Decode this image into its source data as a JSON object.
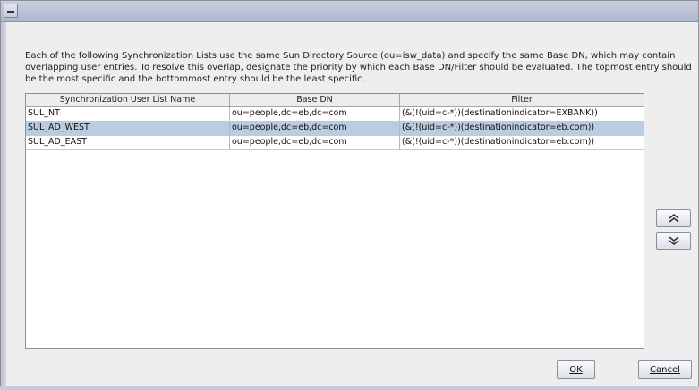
{
  "window": {
    "description": "Each of the following Synchronization Lists use the same Sun Directory Source (ou=isw_data) and specify the same Base DN, which may contain overlapping user entries. To resolve this overlap, designate the priority by which each Base DN/Filter should be evaluated.  The topmost entry should be the most specific and the bottommost entry should be the least specific."
  },
  "table": {
    "headers": [
      "Synchronization User List Name",
      "Base DN",
      "Filter"
    ],
    "rows": [
      {
        "name": "SUL_NT",
        "base_dn": "ou=people,dc=eb,dc=com",
        "filter": "(&(!(uid=c-*))(destinationindicator=EXBANK))",
        "selected": false
      },
      {
        "name": "SUL_AD_WEST",
        "base_dn": "ou=people,dc=eb,dc=com",
        "filter": "(&(!(uid=c-*))(destinationindicator=eb.com))",
        "selected": true
      },
      {
        "name": "SUL_AD_EAST",
        "base_dn": "ou=people,dc=eb,dc=com",
        "filter": "(&(!(uid=c-*))(destinationindicator=eb.com))",
        "selected": false
      }
    ]
  },
  "buttons": {
    "move_up_icon": "double-chevron-up-icon",
    "move_down_icon": "double-chevron-down-icon",
    "ok": "OK",
    "cancel": "Cancel"
  },
  "colors": {
    "selection": "#b9cce0",
    "titlebar": "#aeb6cf"
  }
}
